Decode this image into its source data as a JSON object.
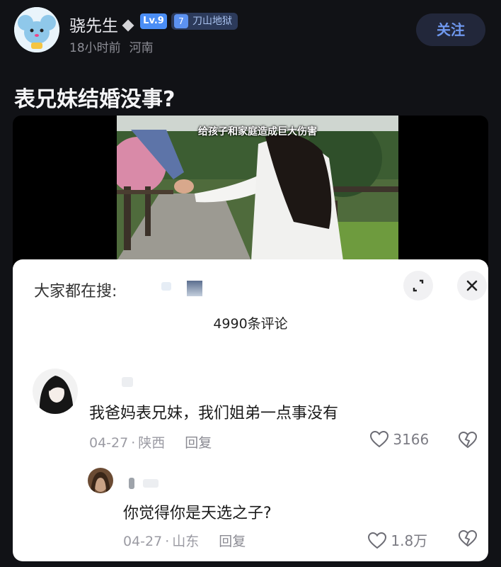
{
  "author": {
    "name": "骁先生",
    "level": "Lv.9",
    "rank_num": "7",
    "rank_title": "刀山地狱",
    "time": "18小时前",
    "location": "河南",
    "follow_label": "关注"
  },
  "post": {
    "title": "表兄妹结婚没事?",
    "video_caption": "给孩子和家庭造成巨大伤害"
  },
  "sheet": {
    "search_label": "大家都在搜:",
    "comment_count": "4990条评论"
  },
  "comments": [
    {
      "text": "我爸妈表兄妹，我们姐弟一点事没有",
      "date": "04-27",
      "location": "陕西",
      "reply_label": "回复",
      "likes": "3166"
    },
    {
      "text": "你觉得你是天选之子?",
      "date": "04-27",
      "location": "山东",
      "reply_label": "回复",
      "likes": "1.8万"
    }
  ],
  "icons": [
    "avatar-mouse-icon",
    "diamond-icon",
    "expand-icon",
    "close-icon",
    "heart-icon",
    "broken-heart-icon"
  ],
  "colors": {
    "accent": "#4b8ef5",
    "follow_text": "#6f98ee",
    "background": "#111216"
  }
}
